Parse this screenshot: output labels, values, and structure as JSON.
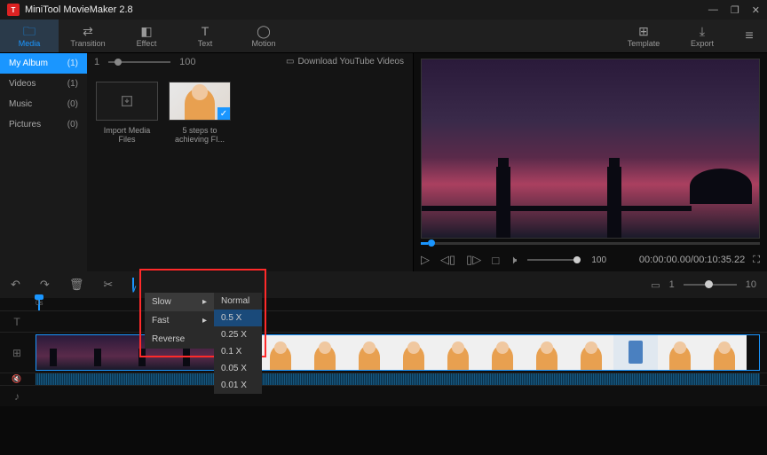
{
  "app": {
    "title": "MiniTool MovieMaker 2.8"
  },
  "toolbar": {
    "left": [
      {
        "label": "Media",
        "active": true
      },
      {
        "label": "Transition"
      },
      {
        "label": "Effect"
      },
      {
        "label": "Text"
      },
      {
        "label": "Motion"
      }
    ],
    "right": [
      {
        "label": "Template"
      },
      {
        "label": "Export"
      }
    ]
  },
  "sidebar": {
    "items": [
      {
        "label": "My Album",
        "count": "(1)",
        "active": true
      },
      {
        "label": "Videos",
        "count": "(1)"
      },
      {
        "label": "Music",
        "count": "(0)"
      },
      {
        "label": "Pictures",
        "count": "(0)"
      }
    ]
  },
  "media": {
    "zoom_min": "1",
    "zoom_max": "100",
    "download_label": "Download YouTube Videos",
    "import_label": "Import Media Files",
    "items": [
      {
        "label": "5 steps to achieving FI..."
      }
    ]
  },
  "preview": {
    "time_current": "00:00:00.00",
    "time_total": "00:10:35.22",
    "volume": "100"
  },
  "timeline": {
    "zoom_min": "1",
    "zoom_max": "10",
    "ruler_start": "0s"
  },
  "speed_menu": {
    "items": [
      {
        "label": "Slow",
        "has_sub": true,
        "highlight": true
      },
      {
        "label": "Fast",
        "has_sub": true
      },
      {
        "label": "Reverse"
      }
    ],
    "sub": [
      {
        "label": "Normal"
      },
      {
        "label": "0.5 X",
        "highlight": true
      },
      {
        "label": "0.25 X"
      },
      {
        "label": "0.1 X"
      },
      {
        "label": "0.05 X"
      },
      {
        "label": "0.01 X"
      }
    ]
  }
}
